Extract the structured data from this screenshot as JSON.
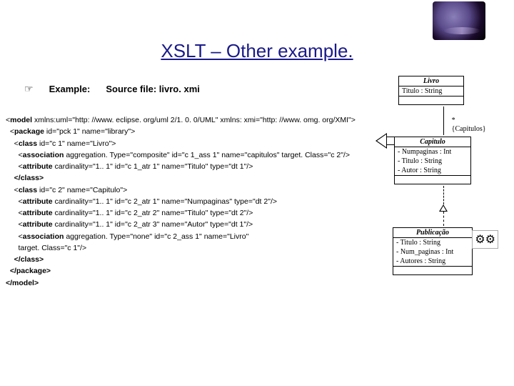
{
  "title": "XSLT – Other example.",
  "example_label": "Example:",
  "source_label": "Source file: livro. xmi",
  "xml": {
    "l1a": "<",
    "l1b": "model",
    "l1c": " xmlns:uml=\"http: //www. eclipse. org/uml 2/1. 0. 0/UML\" xmlns: xmi=\"http: //www. omg. org/XMI\">",
    "l2a": "  <",
    "l2b": "package",
    "l2c": " id=\"pck 1\" name=\"library\">",
    "l3a": "    <",
    "l3b": "class",
    "l3c": " id=\"c 1\" name=\"Livro\">",
    "l4a": "      <",
    "l4b": "association",
    "l4c": " aggregation. Type=\"composite\" id=\"c 1_ass 1\" name=\"capitulos\" target. Class=\"c 2\"/>",
    "l5a": "      <",
    "l5b": "attribute",
    "l5c": " cardinality=\"1.. 1\" id=\"c 1_atr 1\" name=\"Titulo\" type=\"dt 1\"/>",
    "l6": "    </class>",
    "l7a": "    <",
    "l7b": "class",
    "l7c": " id=\"c 2\" name=\"Capitulo\">",
    "l8a": "      <",
    "l8b": "attribute",
    "l8c": " cardinality=\"1.. 1\" id=\"c 2_atr 1\" name=\"Numpaginas\" type=\"dt 2\"/>",
    "l9a": "      <",
    "l9b": "attribute",
    "l9c": " cardinality=\"1.. 1\" id=\"c 2_atr 2\" name=\"Titulo\" type=\"dt 2\"/>",
    "l10a": "      <",
    "l10b": "attribute",
    "l10c": " cardinality=\"1.. 1\" id=\"c 2_atr 3\" name=\"Autor\" type=\"dt 1\"/>",
    "l11a": "      <",
    "l11b": "association",
    "l11c": " aggregation. Type=\"none\" id=\"c 2_ass 1\" name=\"Livro\"",
    "l12": "      target. Class=\"c 1\"/>",
    "l13": "    </class>",
    "l14": "  </package>",
    "l15": "</model>"
  },
  "diagram": {
    "livro": {
      "title": "Livro",
      "attr1": "Titulo : String"
    },
    "conn1": {
      "mult": "*",
      "role": "{Capitulos}"
    },
    "capitulo": {
      "title": "Capitulo",
      "attr1": "- Numpaginas : Int",
      "attr2": "- Titulo : String",
      "attr3": "- Autor : String"
    },
    "publicacao": {
      "title": "Publicação",
      "attr1": "- Titulo : String",
      "attr2": "- Num_paginas : Int",
      "attr3": "- Autores : String"
    }
  },
  "gears": "⚙⚙"
}
